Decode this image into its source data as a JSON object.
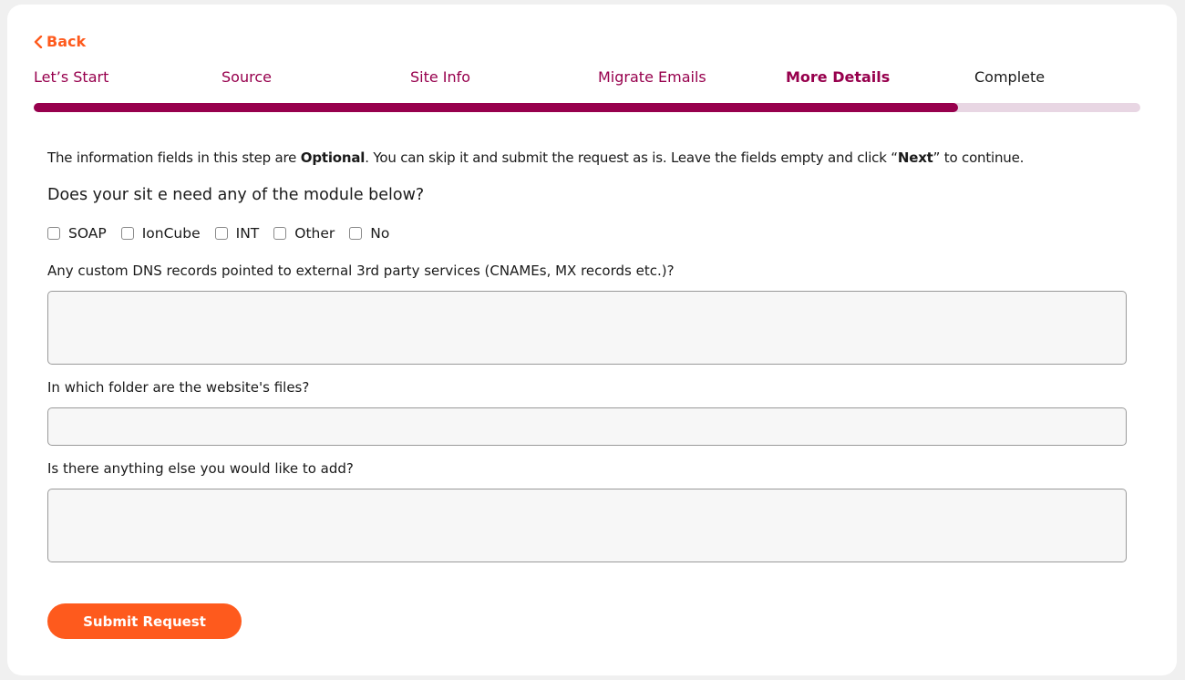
{
  "nav": {
    "back_label": "Back"
  },
  "steps": [
    {
      "label": "Let’s Start",
      "state": "done"
    },
    {
      "label": "Source",
      "state": "done"
    },
    {
      "label": "Site Info",
      "state": "done"
    },
    {
      "label": "Migrate Emails",
      "state": "done"
    },
    {
      "label": "More Details",
      "state": "active"
    },
    {
      "label": "Complete",
      "state": "future"
    }
  ],
  "progress": {
    "fraction": 0.835
  },
  "intro": {
    "part1": "The information fields in this step are ",
    "bold1": "Optional",
    "part2": ". You can skip it and submit the request as is. Leave the fields empty and click “",
    "bold2": "Next",
    "part3": "” to continue."
  },
  "modules": {
    "question": "Does your sit e need any of the module below?",
    "options": [
      {
        "label": "SOAP",
        "checked": false
      },
      {
        "label": "IonCube",
        "checked": false
      },
      {
        "label": "INT",
        "checked": false
      },
      {
        "label": "Other",
        "checked": false
      },
      {
        "label": "No",
        "checked": false
      }
    ]
  },
  "fields": {
    "dns_label": "Any custom DNS records pointed to external 3rd party services (CNAMEs, MX records etc.)?",
    "dns_value": "",
    "folder_label": "In which folder are the website's files?",
    "folder_value": "",
    "extra_label": "Is there anything else you would like to add?",
    "extra_value": ""
  },
  "submit_label": "Submit Request",
  "colors": {
    "brand_orange": "#fe5a1d",
    "brand_magenta": "#97004d",
    "progress_track": "#e8d6e3"
  },
  "icons": {
    "back": "chevron-left-icon"
  }
}
